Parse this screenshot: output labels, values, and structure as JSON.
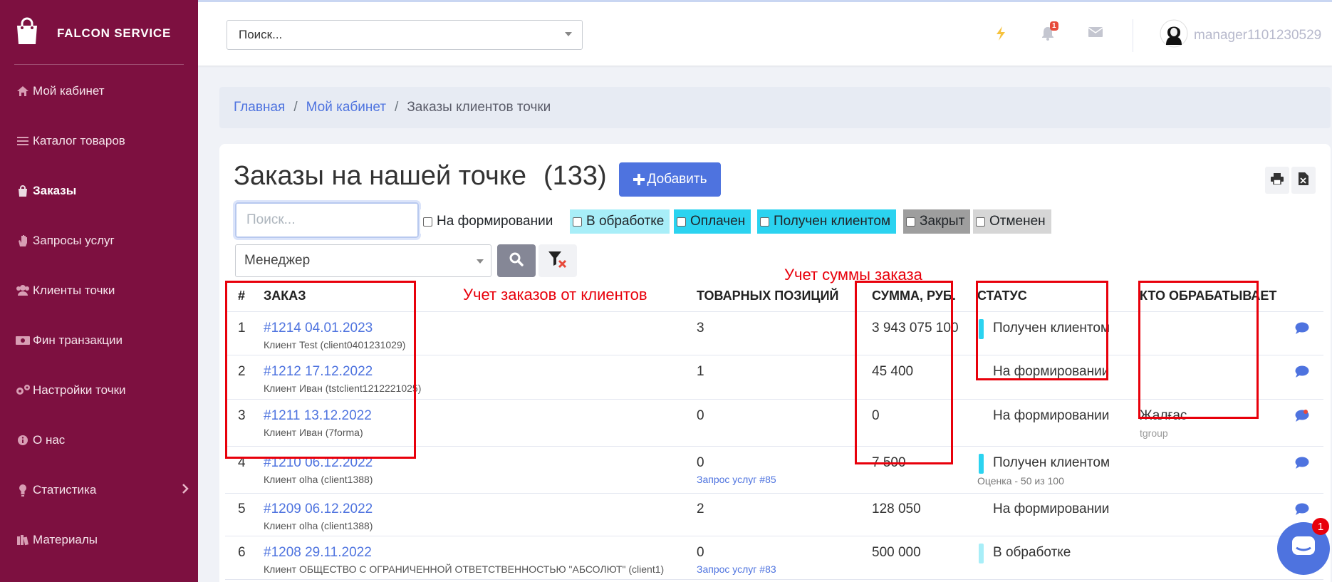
{
  "brand": {
    "name": "FALCON SERVICE",
    "icon": "shopping-bag-icon"
  },
  "sidebar": {
    "items": [
      {
        "label": "Мой кабинет",
        "icon": "home-icon"
      },
      {
        "label": "Каталог товаров",
        "icon": "list-icon"
      },
      {
        "label": "Заказы",
        "icon": "bag-icon",
        "active": true
      },
      {
        "label": "Запросы услуг",
        "icon": "hand-icon"
      },
      {
        "label": "Клиенты точки",
        "icon": "users-icon"
      },
      {
        "label": "Фин транзакции",
        "icon": "money-icon"
      },
      {
        "label": "Настройки точки",
        "icon": "cogs-icon"
      },
      {
        "label": "О нас",
        "icon": "info-icon"
      },
      {
        "label": "Статистика",
        "icon": "bulb-icon"
      },
      {
        "label": "Материалы",
        "icon": "books-icon"
      }
    ]
  },
  "topbar": {
    "search_placeholder": "Поиск...",
    "notifications_count": "1",
    "username": "manager1101230529"
  },
  "breadcrumb": {
    "home": "Главная",
    "cabinet": "Мой кабинет",
    "current": "Заказы клиентов точки"
  },
  "page": {
    "title": "Заказы на нашей точке",
    "count": "(133)",
    "add_label": "Добавить",
    "search_placeholder": "Поиск...",
    "manager_select": "Менеджер"
  },
  "filters": [
    {
      "label": "На формировании",
      "color": "#ffffff"
    },
    {
      "label": "В обработке",
      "color": "#a8eef8"
    },
    {
      "label": "Оплачен",
      "color": "#2bd3f0"
    },
    {
      "label": "Получен клиентом",
      "color": "#2bd3f0"
    },
    {
      "label": "Закрыт",
      "color": "#9e9e9e"
    },
    {
      "label": "Отменен",
      "color": "#d6d6d6"
    }
  ],
  "table": {
    "headers": {
      "num": "#",
      "order": "ЗАКАЗ",
      "items": "ТОВАРНЫХ ПОЗИЦИЙ",
      "sum": "СУММА, РУБ.",
      "status": "СТАТУС",
      "handler": "КТО ОБРАБАТЫВАЕТ"
    },
    "rows": [
      {
        "num": "1",
        "order": "#1214 04.01.2023",
        "client": "Клиент Test (client0401231029)",
        "items": "3",
        "items_link": "",
        "sum": "3 943 075 100",
        "status": "Получен клиентом",
        "status_color": "#2bd3f0",
        "status_note": "",
        "handler": "",
        "handler_sub": ""
      },
      {
        "num": "2",
        "order": "#1212 17.12.2022",
        "client": "Клиент Иван (tstclient1212221025)",
        "items": "1",
        "items_link": "",
        "sum": "45 400",
        "status": "На формировании",
        "status_color": "",
        "status_note": "",
        "handler": "",
        "handler_sub": ""
      },
      {
        "num": "3",
        "order": "#1211 13.12.2022",
        "client": "Клиент Иван (7forma)",
        "items": "0",
        "items_link": "",
        "sum": "0",
        "status": "На формировании",
        "status_color": "",
        "status_note": "",
        "handler": "Жалғас",
        "handler_sub": "tgroup"
      },
      {
        "num": "4",
        "order": "#1210 06.12.2022",
        "client": "Клиент olha (client1388)",
        "items": "0",
        "items_link": "Запрос услуг #85",
        "sum": "7 500",
        "status": "Получен клиентом",
        "status_color": "#2bd3f0",
        "status_note": "Оценка - 50 из 100",
        "handler": "",
        "handler_sub": ""
      },
      {
        "num": "5",
        "order": "#1209 06.12.2022",
        "client": "Клиент olha (client1388)",
        "items": "2",
        "items_link": "",
        "sum": "128 050",
        "status": "На формировании",
        "status_color": "",
        "status_note": "",
        "handler": "",
        "handler_sub": ""
      },
      {
        "num": "6",
        "order": "#1208 29.11.2022",
        "client": "Клиент ОБЩЕСТВО С ОГРАНИЧЕННОЙ ОТВЕТСТВЕННОСТЬЮ \"АБСОЛЮТ\" (client1)",
        "items": "0",
        "items_link": "Запрос услуг #83",
        "sum": "500 000",
        "status": "В обработке",
        "status_color": "#a8eef8",
        "status_note": "",
        "handler": "",
        "handler_sub": ""
      }
    ]
  },
  "annotations": {
    "orders_label": "Учет заказов от клиентов",
    "sum_label": "Учет суммы заказа",
    "color": "#e8000b"
  },
  "chat_badge": "1"
}
